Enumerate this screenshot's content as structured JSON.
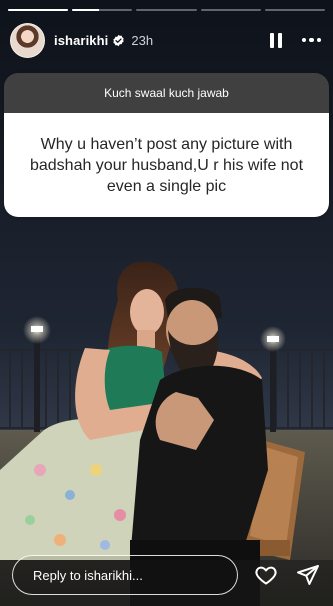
{
  "story": {
    "progress": [
      1,
      0,
      0,
      0,
      0
    ],
    "progress_current_fill": 0.45
  },
  "header": {
    "username": "isharikhi",
    "timestamp": "23h",
    "verified": true,
    "icons": {
      "avatar": "profile-avatar",
      "verified": "verified-badge-icon",
      "pause": "pause-icon",
      "more": "more-options-icon"
    }
  },
  "sticker": {
    "prompt": "Kuch swaal kuch jawab",
    "question": "Why u haven’t post any picture with badshah your husband,U r his wife not even a single pic"
  },
  "reply": {
    "placeholder": "Reply to isharikhi...",
    "icons": {
      "like": "heart-icon",
      "share": "send-icon"
    }
  },
  "colors": {
    "sticker_header": "#404040",
    "sticker_body": "#ffffff",
    "sky_top": "#121722",
    "sky_bottom": "#2e3646"
  }
}
